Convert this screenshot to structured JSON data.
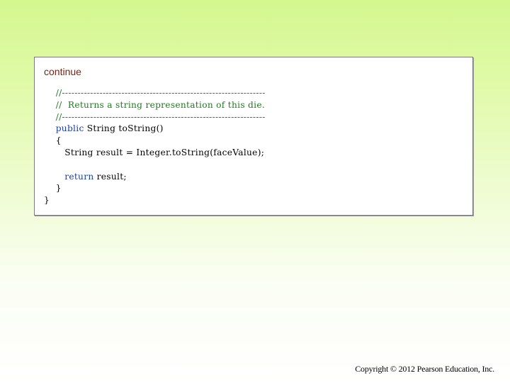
{
  "slide": {
    "continue_label": "continue",
    "copyright": "Copyright © 2012 Pearson Education, Inc."
  },
  "code": {
    "line1": "//-----------------------------------------------------------------",
    "line2": "//  Returns a string representation of this die.",
    "line3": "//-----------------------------------------------------------------",
    "line4_keyword": "public",
    "line4_rest": " String toString()",
    "line5": "{",
    "line6": "String result = Integer.toString(faceValue);",
    "line8_keyword": "return",
    "line8_rest": " result;",
    "line9": "}",
    "line10": "}"
  },
  "colors": {
    "comment": "#1f7a1f",
    "keyword": "#1a3d99",
    "continue_label": "#7a1f0f",
    "background_top": "#d4f78f",
    "background_bottom": "#ffffff"
  }
}
